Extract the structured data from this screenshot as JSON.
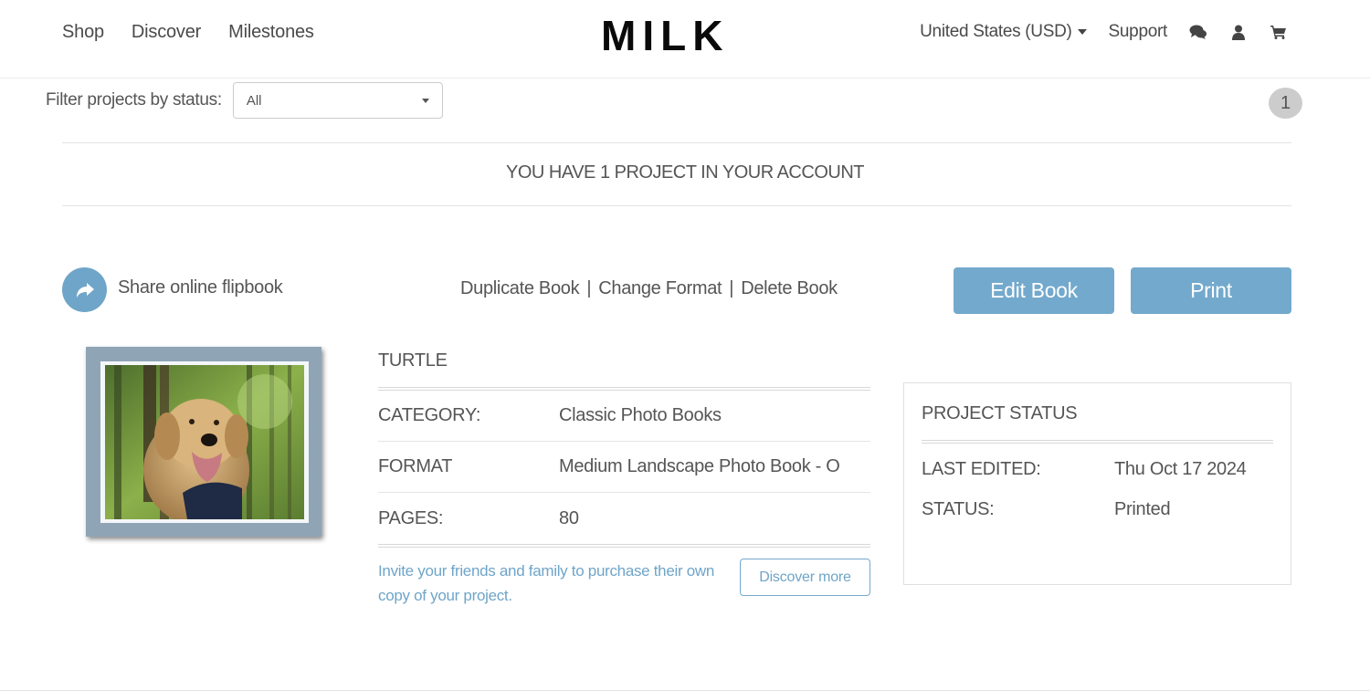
{
  "header": {
    "nav": [
      {
        "label": "Shop"
      },
      {
        "label": "Discover"
      },
      {
        "label": "Milestones"
      }
    ],
    "logo": "MILK",
    "currency": "United States (USD)",
    "support": "Support",
    "icons": [
      "chat-icon",
      "user-icon",
      "cart-icon"
    ]
  },
  "filter": {
    "label": "Filter projects by status:",
    "selected": "All"
  },
  "pagination": {
    "current_page": "1"
  },
  "summary": {
    "project_count_text": "YOU HAVE 1 PROJECT IN YOUR ACCOUNT"
  },
  "actions": {
    "share_label": "Share online flipbook",
    "duplicate": "Duplicate Book",
    "change_format": "Change Format",
    "delete": "Delete Book",
    "separator": "|",
    "edit_button": "Edit Book",
    "print_button": "Print"
  },
  "project": {
    "title": "TURTLE",
    "details": [
      {
        "key": "CATEGORY:",
        "value": "Classic Photo Books"
      },
      {
        "key": "FORMAT",
        "value": "Medium Landscape Photo Book - O"
      },
      {
        "key": "PAGES:",
        "value": "80"
      }
    ],
    "invite_text": "Invite your friends and family to purchase their own copy of your project.",
    "discover_button": "Discover more",
    "cover_alt": "Golden retriever in forest"
  },
  "status_panel": {
    "title": "PROJECT STATUS",
    "rows": [
      {
        "key": "LAST EDITED:",
        "value": "Thu Oct 17 2024"
      },
      {
        "key": "STATUS:",
        "value": "Printed"
      }
    ]
  },
  "colors": {
    "accent": "#73a9cc",
    "text": "#555555",
    "badge": "#cccccc"
  }
}
